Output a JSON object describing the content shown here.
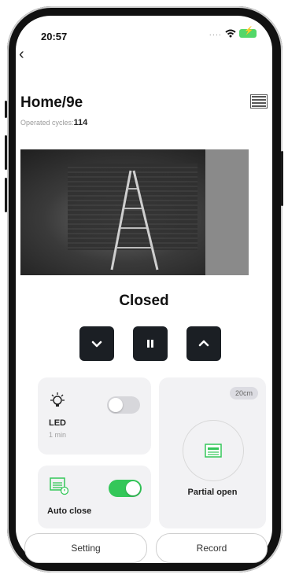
{
  "status": {
    "time": "20:57",
    "dots": "....",
    "wifi_icon": "wifi-icon",
    "battery_icon": "battery-charging-icon"
  },
  "header": {
    "back_icon": "back-chevron-icon",
    "title": "Home/9e",
    "cycles_label": "Operated cycles:",
    "cycles_value": "114",
    "menu_icon": "garage-door-list-icon"
  },
  "door": {
    "state": "Closed"
  },
  "controls": [
    {
      "name": "close-button",
      "icon": "chevron-down-icon"
    },
    {
      "name": "pause-button",
      "icon": "pause-icon"
    },
    {
      "name": "open-button",
      "icon": "chevron-up-icon"
    }
  ],
  "led": {
    "label": "LED",
    "sub": "1 min",
    "enabled": false,
    "icon": "lightbulb-icon"
  },
  "auto_close": {
    "label": "Auto close",
    "enabled": true,
    "icon": "garage-timer-icon"
  },
  "partial": {
    "chip": "20cm",
    "label": "Partial open",
    "icon": "garage-door-icon"
  },
  "bottom": {
    "setting": "Setting",
    "record": "Record"
  },
  "colors": {
    "accent_green": "#34c759",
    "control_dark": "#1b1f24",
    "card_bg": "#f2f2f4"
  }
}
